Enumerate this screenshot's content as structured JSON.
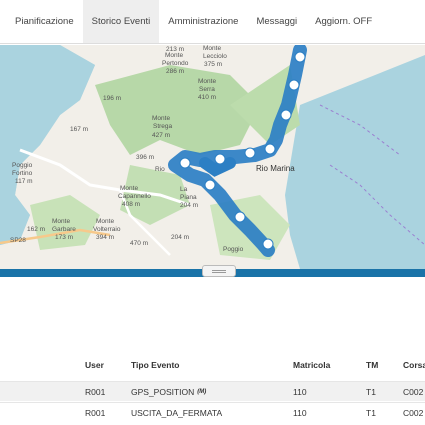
{
  "nav": {
    "tabs": [
      {
        "label": "Pianificazione",
        "active": false
      },
      {
        "label": "Storico Eventi",
        "active": true
      },
      {
        "label": "Amministrazione",
        "active": false
      },
      {
        "label": "Messaggi",
        "active": false
      },
      {
        "label": "Aggiorn. OFF",
        "active": false
      }
    ]
  },
  "map": {
    "labels": {
      "monte_pertondo": "Monte\nPertondo\n286 m",
      "monte_lecciolo": "Monte\nLecciolo\n375 m",
      "monte_serra": "Monte\nSerra\n410 m",
      "m196": "196 m",
      "m167": "167 m",
      "monte_strega": "Monte\nStrega\n427 m",
      "m396": "396 m",
      "poggio_fortino": "Poggio\nFortino\n117 m",
      "rio": "Rio",
      "monte_capannello": "Monte\nCapannello\n408 m",
      "la_piana": "La\nPiana\n204 m",
      "rio_marina": "Rio Marina",
      "monte_garbare": "Monte\nGarbare\n173 m",
      "m162": "162 m",
      "monte_volterraio": "Monte\nVolterraio\n394 m",
      "m470": "470 m",
      "m204": "204 m",
      "sp28": "SP28",
      "poggio": "Poggio",
      "m213": "213 m",
      "m6": "6"
    }
  },
  "table": {
    "headers": {
      "user": "User",
      "tipo": "Tipo Evento",
      "matricola": "Matricola",
      "tm": "TM",
      "corsa": "Corsa"
    },
    "rows": [
      {
        "user": "R001",
        "tipo": "GPS_POSITION",
        "tipo_badge": "(M)",
        "matricola": "110",
        "tm": "T1",
        "corsa": "C002"
      },
      {
        "user": "R001",
        "tipo": "USCITA_DA_FERMATA",
        "matricola": "110",
        "tm": "T1",
        "corsa": "C002"
      }
    ]
  },
  "colors": {
    "accent": "#1a73a8",
    "route": "#2c7fc4",
    "marker": "#3b82d0",
    "land": "#f2efe9",
    "forest": "#b7d8a8",
    "sea": "#aad3df"
  }
}
